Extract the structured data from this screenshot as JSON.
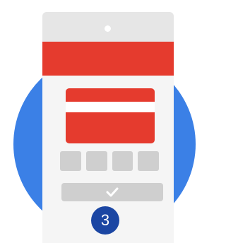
{
  "colors": {
    "blue": "#3b80e6",
    "red": "#e53b2e",
    "navy": "#1b46a3",
    "check": "#ffffff"
  },
  "icons": {
    "camera": "camera-dot-icon",
    "confirm": "checkmark-icon"
  },
  "step_badge": {
    "label": "3"
  }
}
